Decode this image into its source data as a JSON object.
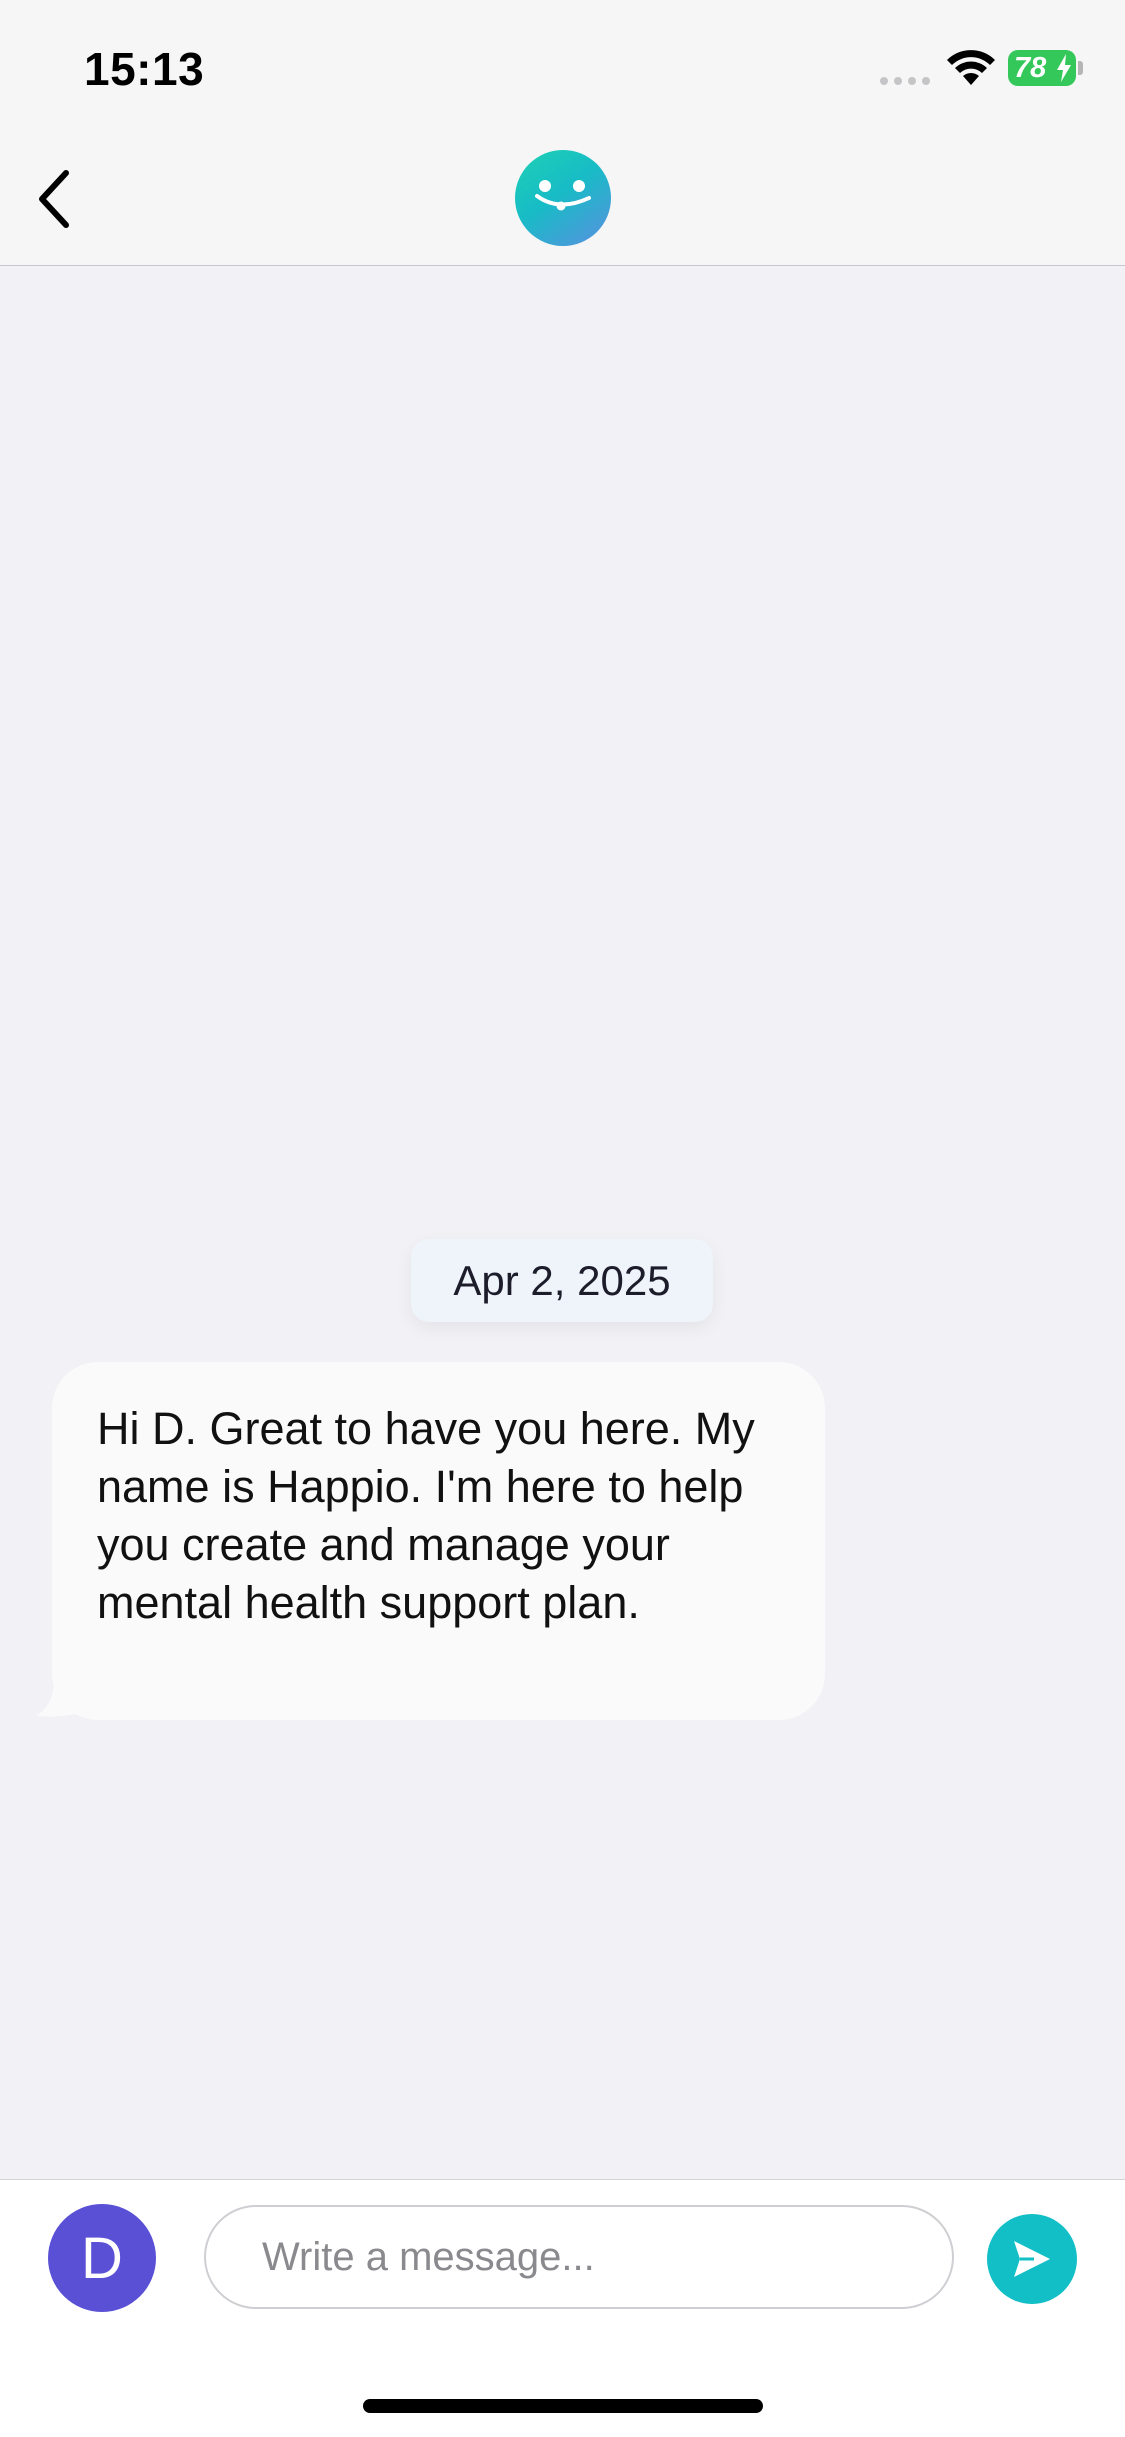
{
  "status_bar": {
    "time": "15:13",
    "battery_level": "78",
    "battery_charging": true,
    "battery_color": "#34c759"
  },
  "nav": {
    "back_icon": "chevron-left-icon",
    "avatar_icon": "smiley-face-icon",
    "avatar_gradient": [
      "#1ed1b3",
      "#5a8fe0"
    ]
  },
  "chat": {
    "date_label": "Apr 2, 2025",
    "messages": [
      {
        "sender": "bot",
        "text": "Hi D. Great to have you here. My name is Happio. I'm here to help you create and manage your mental health support plan."
      }
    ]
  },
  "composer": {
    "user_initial": "D",
    "user_avatar_color": "#5a50d6",
    "placeholder": "Write a message...",
    "value": "",
    "send_icon": "send-icon",
    "send_color": "#12bfc6"
  }
}
